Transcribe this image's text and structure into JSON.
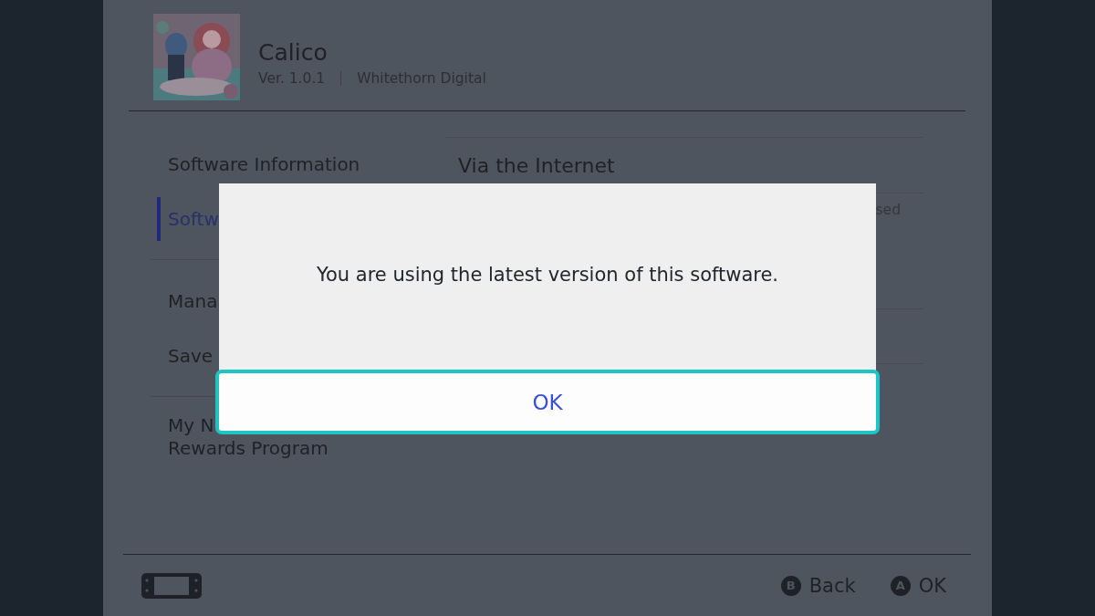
{
  "header": {
    "title": "Calico",
    "version": "Ver. 1.0.1",
    "publisher": "Whitethorn Digital"
  },
  "menu": {
    "groups": [
      [
        {
          "lines": [
            "Software Information"
          ],
          "selected": false
        },
        {
          "lines": [
            "Softw"
          ],
          "selected": true
        }
      ],
      [
        {
          "lines": [
            "Mana"
          ],
          "selected": false
        },
        {
          "lines": [
            "Save"
          ],
          "selected": false
        }
      ],
      [
        {
          "lines": [
            "My N",
            "Rewards Program"
          ],
          "selected": false
        }
      ]
    ]
  },
  "details": {
    "heading": "Via the Internet",
    "note": "sed"
  },
  "dialog": {
    "message": "You are using the latest version of this software.",
    "button": {
      "label": "OK",
      "focused": true
    }
  },
  "footer": {
    "buttons": [
      {
        "key": "B",
        "label": "Back"
      },
      {
        "key": "A",
        "label": "OK"
      }
    ]
  }
}
